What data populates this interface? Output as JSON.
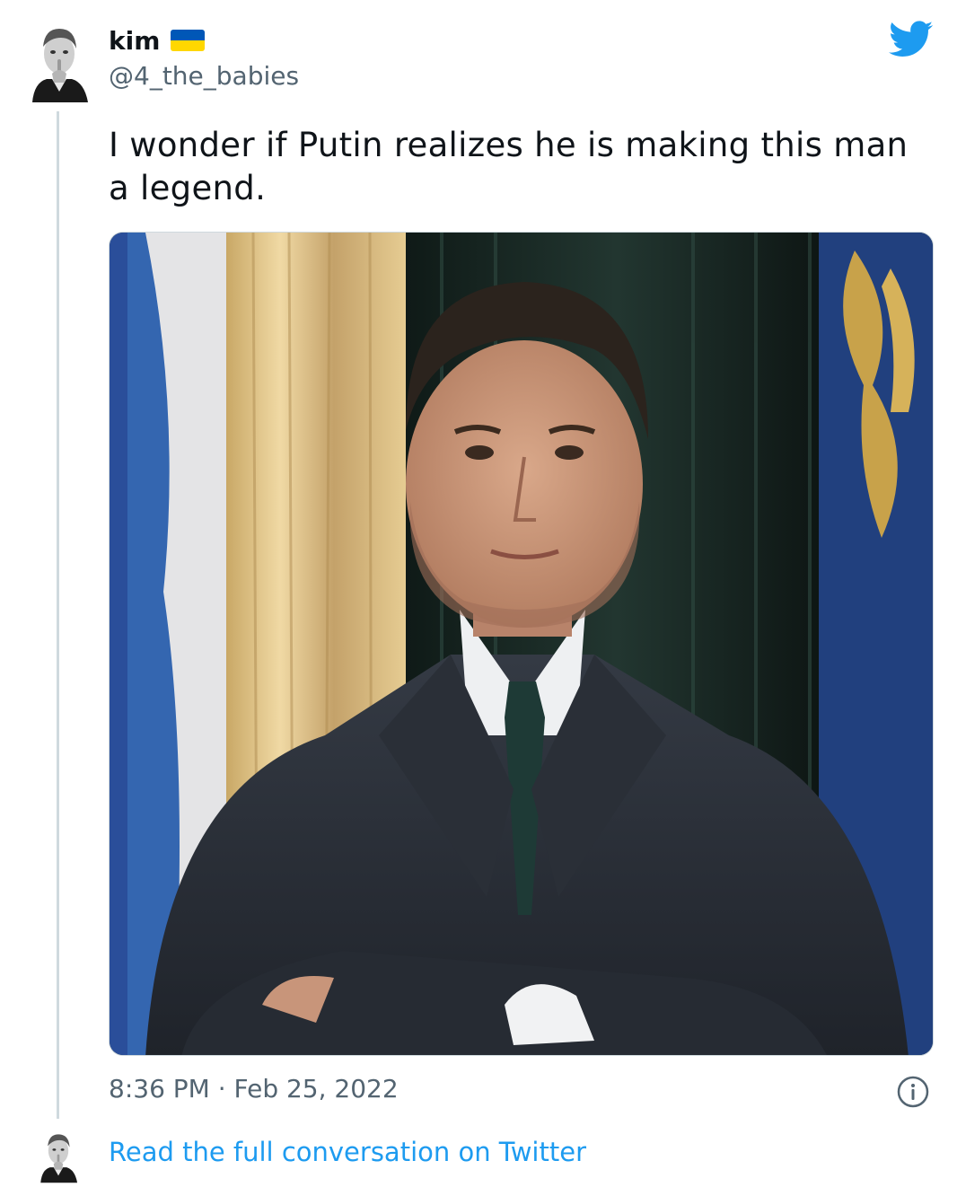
{
  "author": {
    "display_name": "kim",
    "handle": "@4_the_babies",
    "flag": {
      "top_color": "#0057b7",
      "bottom_color": "#ffd700"
    }
  },
  "tweet": {
    "text": "I wonder if Putin realizes he is making this man a legend.",
    "timestamp": "8:36 PM · Feb 25, 2022"
  },
  "footer": {
    "link_text": "Read the full conversation on Twitter"
  },
  "icons": {
    "brand": "twitter-bird-icon",
    "info": "info-icon"
  },
  "colors": {
    "brand_blue": "#1d9bf0",
    "muted_text": "#536471",
    "thread_line": "#cfd9de"
  }
}
